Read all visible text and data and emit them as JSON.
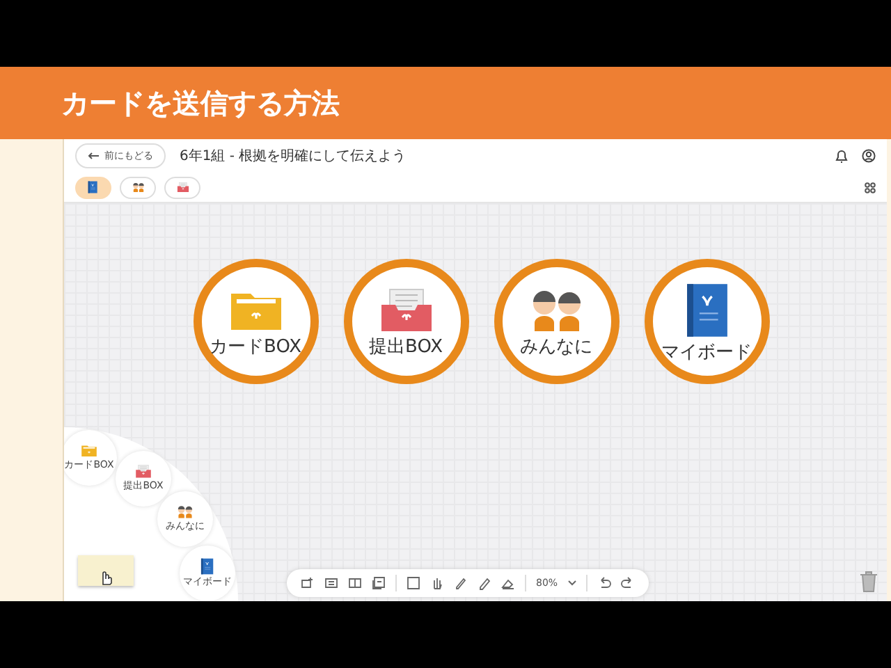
{
  "slide_title": "カードを送信する方法",
  "app": {
    "back_button": "前にもどる",
    "title": "6年1組 - 根拠を明確にして伝えよう",
    "tabs": [
      {
        "kind": "board",
        "selected": true
      },
      {
        "kind": "people",
        "selected": false
      },
      {
        "kind": "tray",
        "selected": false
      }
    ],
    "send_targets": [
      {
        "kind": "folder",
        "label": "カードBOX"
      },
      {
        "kind": "tray",
        "label": "提出BOX"
      },
      {
        "kind": "people",
        "label": "みんなに"
      },
      {
        "kind": "board",
        "label": "マイボード"
      }
    ],
    "radial_menu": [
      {
        "kind": "folder",
        "label": "カードBOX"
      },
      {
        "kind": "tray",
        "label": "提出BOX"
      },
      {
        "kind": "people",
        "label": "みんなに"
      },
      {
        "kind": "board",
        "label": "マイボード"
      }
    ],
    "toolbar": {
      "zoom": "80%"
    }
  }
}
